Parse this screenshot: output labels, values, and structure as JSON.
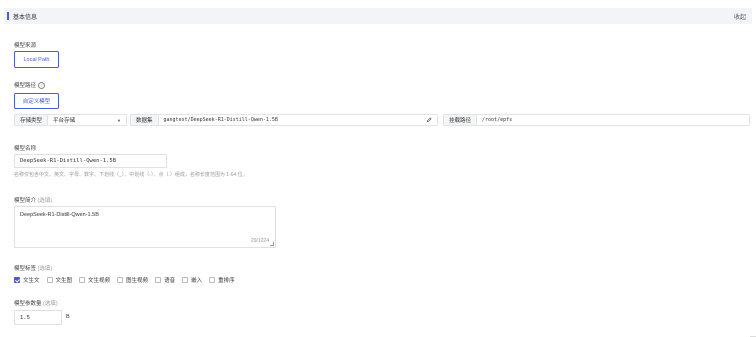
{
  "section": {
    "title": "基本信息",
    "collapse": "收起"
  },
  "model_source": {
    "label": "模型来源",
    "button": "Local Path"
  },
  "model_path": {
    "label": "模型路径",
    "help_icon": "question-circle-icon",
    "custom_button": "自定义模型",
    "storage_type": {
      "label": "存储类型",
      "value": "平台存储"
    },
    "dataset": {
      "label": "数据集",
      "value": "gangtest/DeepSeek-R1-Distill-Qwen-1.5B"
    },
    "mount_path": {
      "label": "挂载路径",
      "value": "/root/epfs"
    }
  },
  "model_name": {
    "label": "模型名称",
    "value": "DeepSeek-R1-Distill-Qwen-1.5B",
    "help": "名称仅包含中文、英文、字母、数字、下划线（_）、中划线（-）、点（.）组成，名称长度范围为 1-64 位。"
  },
  "model_intro": {
    "label": "模型简介",
    "optional": "(选填)",
    "value": "DeepSeek-R1-Distill-Qwen-1.5B",
    "counter": "29/1024"
  },
  "model_tags": {
    "label": "模型标签",
    "optional": "(选填)",
    "options": [
      {
        "label": "文生文",
        "checked": true
      },
      {
        "label": "文生图",
        "checked": false
      },
      {
        "label": "文生视频",
        "checked": false
      },
      {
        "label": "图生视频",
        "checked": false
      },
      {
        "label": "语音",
        "checked": false
      },
      {
        "label": "嵌入",
        "checked": false
      },
      {
        "label": "重排序",
        "checked": false
      }
    ]
  },
  "model_params": {
    "label": "模型参数量",
    "optional": "(选填)",
    "value": "1.5",
    "unit": "B"
  },
  "colors": {
    "accent": "#4a5bd1",
    "header_bg": "#f3f4f8"
  }
}
